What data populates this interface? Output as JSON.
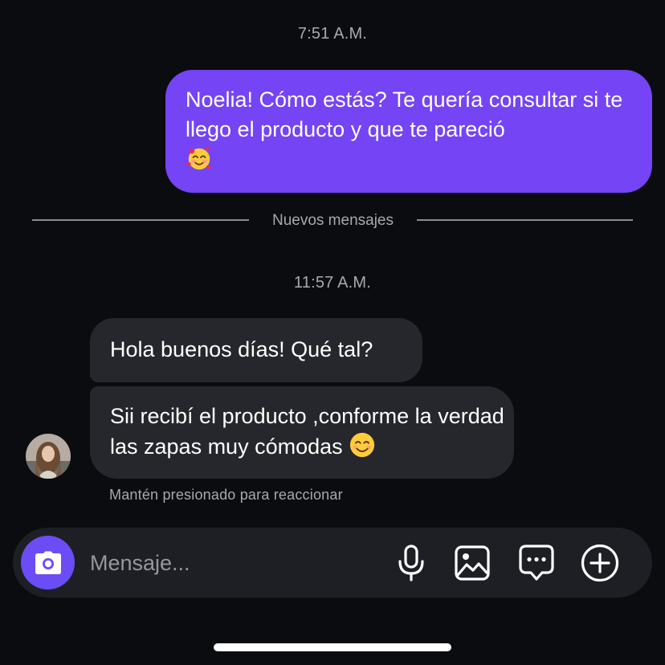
{
  "thread": {
    "timestamp_1": "7:51 A.M.",
    "timestamp_2": "11:57 A.M.",
    "divider_label": "Nuevos mensajes",
    "hint": "Mantén presionado para reaccionar"
  },
  "messages": [
    {
      "sender": "me",
      "text": "Noelia! Cómo estás? Te quería consultar si te llego el producto y que te pareció",
      "emoji": "smiling-face-with-hearts"
    },
    {
      "sender": "contact",
      "text": "Hola buenos días! Qué tal?"
    },
    {
      "sender": "contact",
      "text": "Sii recibí el producto ,conforme la verdad las zapas muy cómodas",
      "emoji": "smiling-face-with-smiling-eyes"
    }
  ],
  "composer": {
    "placeholder": "Mensaje...",
    "value": "",
    "icons": [
      "camera-icon",
      "microphone-icon",
      "gallery-icon",
      "sticker-chat-icon",
      "plus-icon"
    ]
  },
  "colors": {
    "background": "#0b0c10",
    "outgoing_bubble": "#7444f5",
    "incoming_bubble": "#26272c",
    "camera_button": "#6b4cf5",
    "composer": "#1e1f24"
  }
}
